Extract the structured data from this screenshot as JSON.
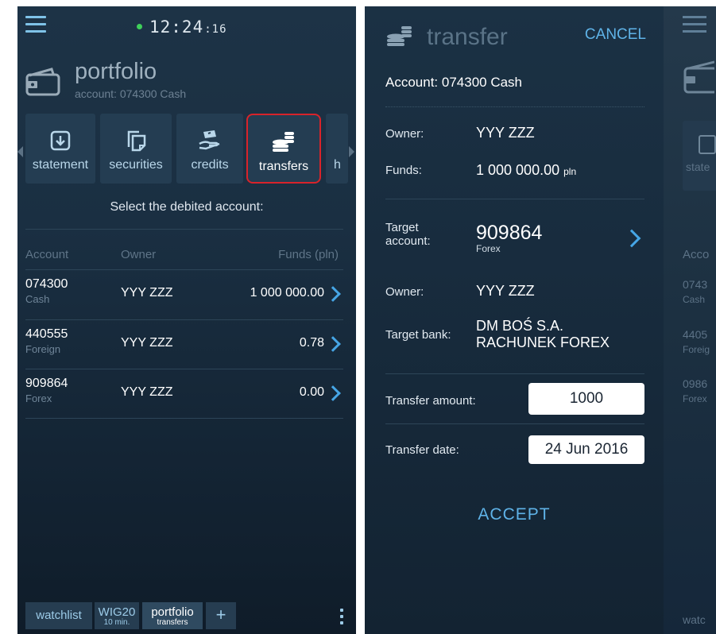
{
  "left": {
    "clock": {
      "hm": "12:24",
      "sec": ":16"
    },
    "portfolio": {
      "title": "portfolio",
      "subtitle": "account: 074300 Cash"
    },
    "tiles": [
      {
        "label": "statement",
        "icon": "statement-download-icon"
      },
      {
        "label": "securities",
        "icon": "securities-copy-icon"
      },
      {
        "label": "credits",
        "icon": "credits-hand-icon"
      },
      {
        "label": "transfers",
        "icon": "coins-stack-icon",
        "selected": true
      },
      {
        "label": "h"
      }
    ],
    "select_label": "Select the debited account:",
    "table": {
      "headers": {
        "account": "Account",
        "owner": "Owner",
        "funds": "Funds (pln)"
      },
      "rows": [
        {
          "account": "074300",
          "type": "Cash",
          "owner": "YYY ZZZ",
          "funds": "1 000 000.00"
        },
        {
          "account": "440555",
          "type": "Foreign",
          "owner": "YYY ZZZ",
          "funds": "0.78"
        },
        {
          "account": "909864",
          "type": "Forex",
          "owner": "YYY ZZZ",
          "funds": "0.00"
        }
      ]
    },
    "bottom_tabs": {
      "watchlist": "watchlist",
      "wig20": {
        "label": "WIG20",
        "sub": "10 min."
      },
      "portfolio": {
        "label": "portfolio",
        "sub": "transfers"
      },
      "add": "+"
    }
  },
  "middle": {
    "title": "transfer",
    "cancel": "CANCEL",
    "account_line": "Account: 074300 Cash",
    "owner_label": "Owner:",
    "owner_value": "YYY ZZZ",
    "funds_label": "Funds:",
    "funds_value": "1 000 000.00",
    "funds_unit": "pln",
    "target_label_1": "Target",
    "target_label_2": "account:",
    "target_value": "909864",
    "target_type": "Forex",
    "owner2_label": "Owner:",
    "owner2_value": "YYY ZZZ",
    "bank_label": "Target bank:",
    "bank_line1": "DM BOŚ S.A.",
    "bank_line2": "RACHUNEK FOREX",
    "amount_label": "Transfer amount:",
    "amount_value": "1000",
    "date_label": "Transfer date:",
    "date_value": "24 Jun 2016",
    "accept": "ACCEPT"
  },
  "right": {
    "tile_text": "state",
    "header": "Acco",
    "rows": [
      {
        "account": "0743",
        "type": "Cash"
      },
      {
        "account": "4405",
        "type": "Foreig"
      },
      {
        "account": "0986",
        "type": "Forex"
      }
    ],
    "bottom": "watc"
  },
  "colors": {
    "accent": "#46a6e6",
    "selected_border": "#d8232a",
    "clock_dot": "#3fd05a"
  }
}
